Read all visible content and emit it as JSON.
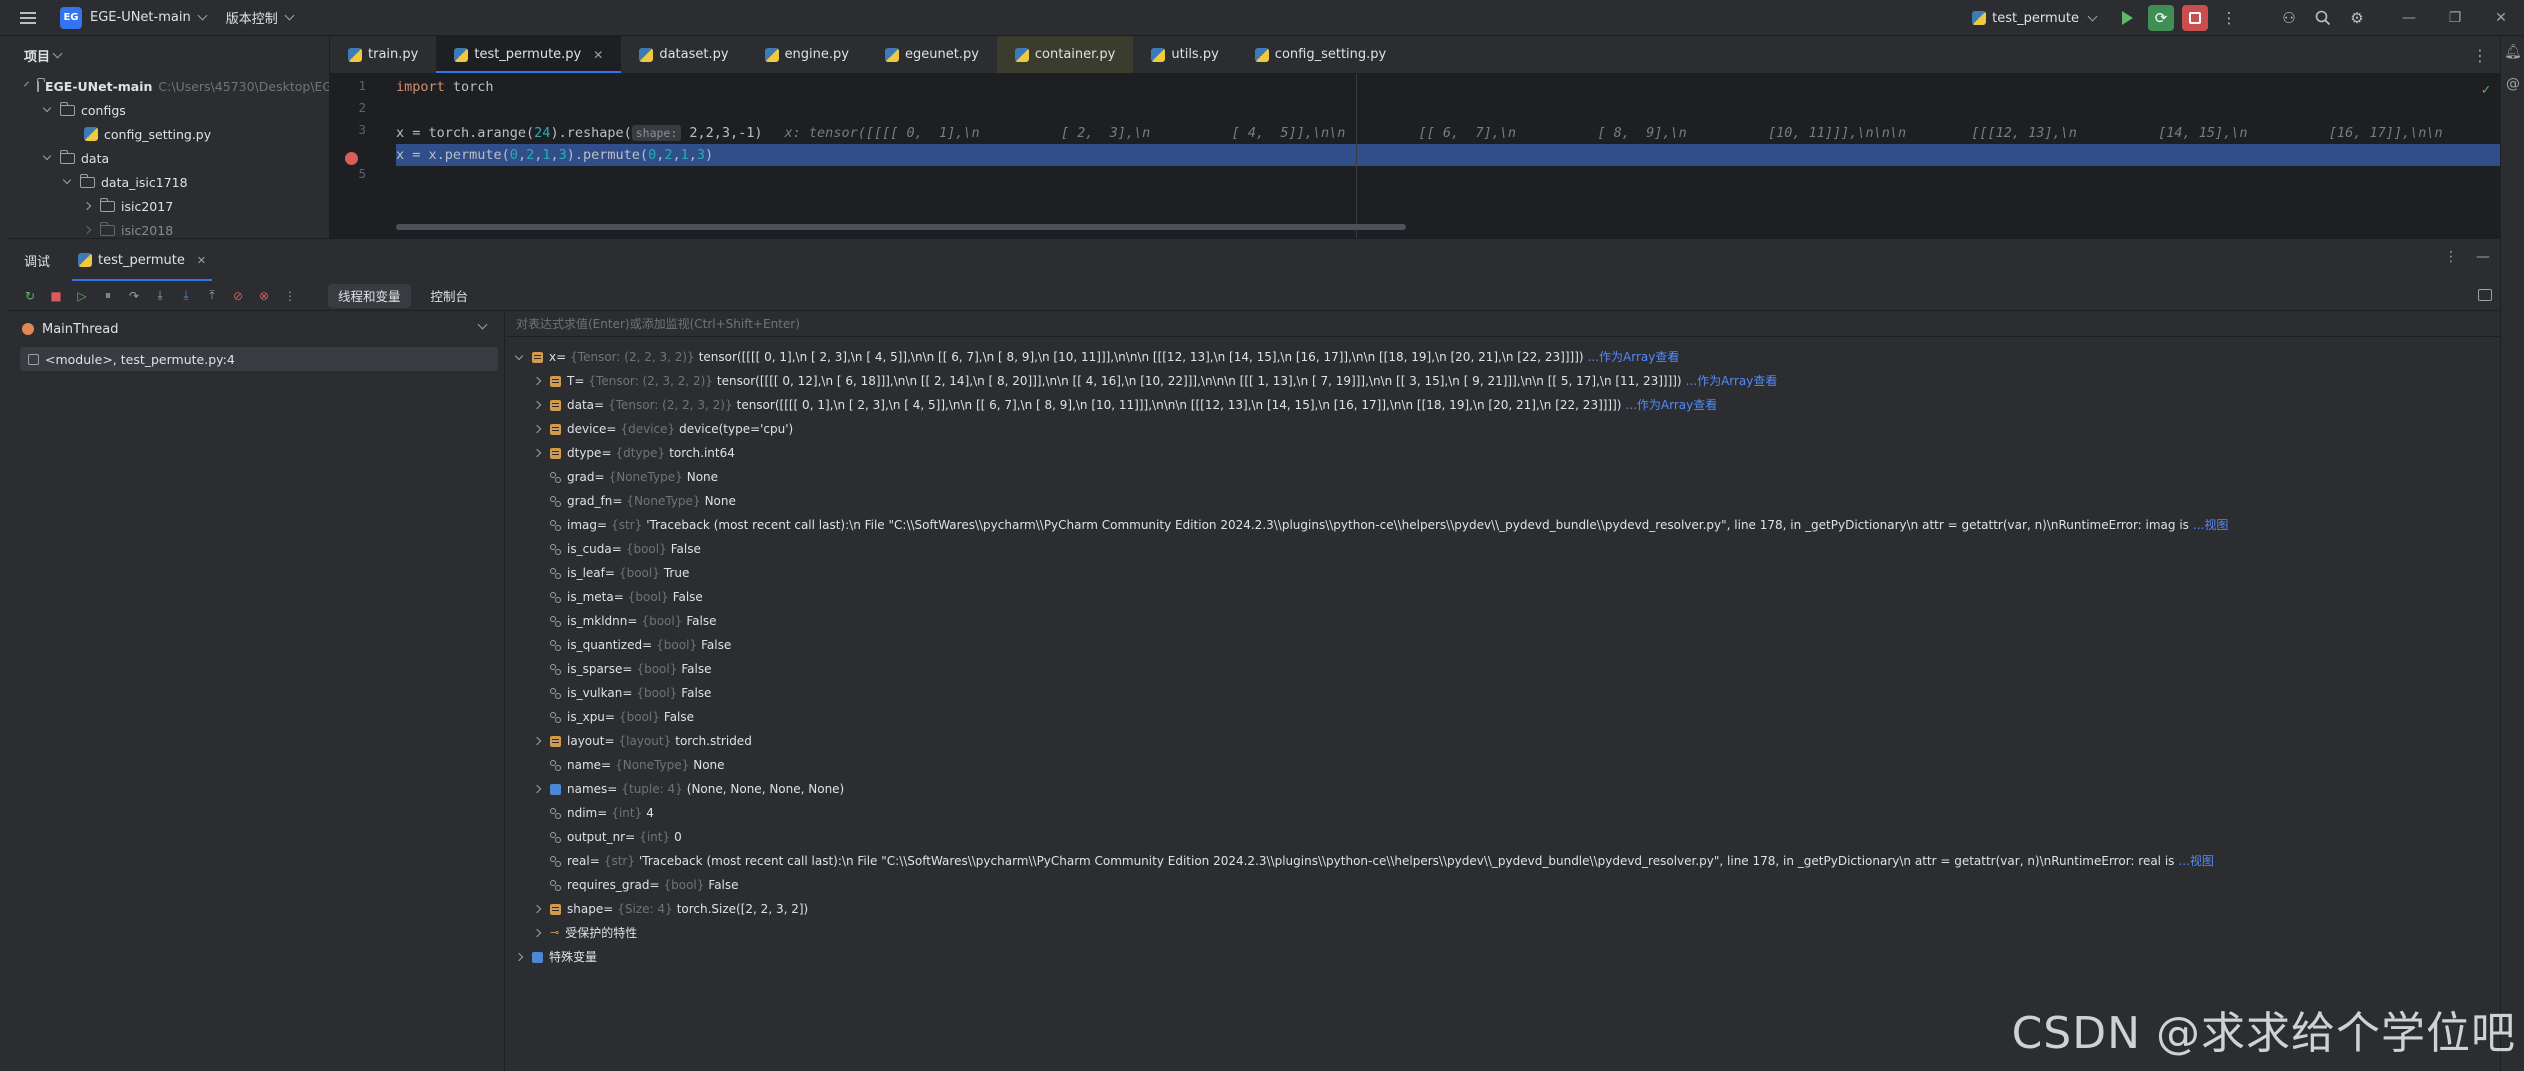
{
  "titlebar": {
    "badge": "EG",
    "project_name": "EGE-UNet-main",
    "vcs_label": "版本控制",
    "run_config": "test_permute"
  },
  "project_panel": {
    "title": "项目",
    "root": {
      "name": "EGE-UNet-main",
      "path": "C:\\Users\\45730\\Desktop\\EG"
    },
    "items": [
      {
        "label": "configs"
      },
      {
        "label": "config_setting.py"
      },
      {
        "label": "data"
      },
      {
        "label": "data_isic1718"
      },
      {
        "label": "isic2017"
      },
      {
        "label": "isic2018"
      }
    ]
  },
  "tabs": [
    {
      "label": "train.py"
    },
    {
      "label": "test_permute.py"
    },
    {
      "label": "dataset.py"
    },
    {
      "label": "engine.py"
    },
    {
      "label": "egeunet.py"
    },
    {
      "label": "container.py"
    },
    {
      "label": "utils.py"
    },
    {
      "label": "config_setting.py"
    }
  ],
  "editor": {
    "line_numbers": [
      "1",
      "2",
      "3",
      "4",
      "5"
    ],
    "line1": {
      "kw": "import",
      "rest": " torch"
    },
    "line3": {
      "a": "x = torch.arange(",
      "n1": "24",
      "b": ").reshape(",
      "hint": "shape:",
      "c": " 2,2,3,-1)",
      "inline": "x: tensor([[[[ 0,  1],\\n          [ 2,  3],\\n          [ 4,  5]],\\n\\n         [[ 6,  7],\\n          [ 8,  9],\\n          [10, 11]]],\\n\\n\\n        [[[12, 13],\\n          [14, 15],\\n          [16, 17]],\\n\\n"
    },
    "line4": {
      "a": "x = x.permute(",
      "n1": "0",
      "s1": ",",
      "n2": "2",
      "s2": ",",
      "n3": "1",
      "s3": ",",
      "n4": "3",
      "b": ").permute(",
      "n5": "0",
      "s5": ",",
      "n6": "2",
      "s6": ",",
      "n7": "1",
      "s7": ",",
      "n8": "3",
      "c": ")"
    }
  },
  "debug": {
    "tool_title": "调试",
    "session_tab": "test_permute",
    "subtab_threads": "线程和变量",
    "subtab_console": "控制台",
    "thread": "MainThread",
    "frame": "<module>, test_permute.py:4",
    "eval_placeholder": "对表达式求值(Enter)或添加监视(Ctrl+Shift+Enter)",
    "variables": [
      {
        "name": "x",
        "type": "{Tensor: (2, 2, 3, 2)}",
        "value": "tensor([[[[ 0,  1],\\n          [ 2,  3],\\n          [ 4,  5]],\\n\\n         [[ 6,  7],\\n          [ 8,  9],\\n          [10, 11]]],\\n\\n\\n        [[[12, 13],\\n          [14, 15],\\n          [16, 17]],\\n\\n         [[18, 19],\\n          [20, 21],\\n          [22, 23]]]])",
        "link": "...作为Array查看"
      },
      {
        "name": "T",
        "type": "{Tensor: (2, 3, 2, 2)}",
        "value": "tensor([[[[ 0, 12],\\n          [ 6, 18]]],\\n\\n         [[ 2, 14],\\n          [ 8, 20]]],\\n\\n         [[ 4, 16],\\n          [10, 22]]],\\n\\n\\n        [[[ 1, 13],\\n          [ 7, 19]]],\\n\\n         [[ 3, 15],\\n          [ 9, 21]]],\\n\\n         [[ 5, 17],\\n          [11, 23]]]])",
        "link": "...作为Array查看"
      },
      {
        "name": "data",
        "type": "{Tensor: (2, 2, 3, 2)}",
        "value": "tensor([[[[ 0,  1],\\n          [ 2,  3],\\n          [ 4,  5]],\\n\\n         [[ 6,  7],\\n          [ 8,  9],\\n          [10, 11]]],\\n\\n\\n        [[[12, 13],\\n          [14, 15],\\n          [16, 17]],\\n\\n         [[18, 19],\\n          [20, 21],\\n          [22, 23]]]])",
        "link": "...作为Array查看"
      },
      {
        "name": "device",
        "type": "{device}",
        "value": "device(type='cpu')",
        "link": ""
      },
      {
        "name": "dtype",
        "type": "{dtype}",
        "value": "torch.int64",
        "link": ""
      },
      {
        "name": "grad",
        "type": "{NoneType}",
        "value": "None",
        "link": ""
      },
      {
        "name": "grad_fn",
        "type": "{NoneType}",
        "value": "None",
        "link": ""
      },
      {
        "name": "imag",
        "type": "{str}",
        "value": "'Traceback (most recent call last):\\n  File \"C:\\\\SoftWares\\\\pycharm\\\\PyCharm Community Edition 2024.2.3\\\\plugins\\\\python-ce\\\\helpers\\\\pydev\\\\_pydevd_bundle\\\\pydevd_resolver.py\", line 178, in _getPyDictionary\\n    attr = getattr(var, n)\\nRuntimeError: imag is",
        "link": "...视图"
      },
      {
        "name": "is_cuda",
        "type": "{bool}",
        "value": "False",
        "link": ""
      },
      {
        "name": "is_leaf",
        "type": "{bool}",
        "value": "True",
        "link": ""
      },
      {
        "name": "is_meta",
        "type": "{bool}",
        "value": "False",
        "link": ""
      },
      {
        "name": "is_mkldnn",
        "type": "{bool}",
        "value": "False",
        "link": ""
      },
      {
        "name": "is_quantized",
        "type": "{bool}",
        "value": "False",
        "link": ""
      },
      {
        "name": "is_sparse",
        "type": "{bool}",
        "value": "False",
        "link": ""
      },
      {
        "name": "is_vulkan",
        "type": "{bool}",
        "value": "False",
        "link": ""
      },
      {
        "name": "is_xpu",
        "type": "{bool}",
        "value": "False",
        "link": ""
      },
      {
        "name": "layout",
        "type": "{layout}",
        "value": "torch.strided",
        "link": ""
      },
      {
        "name": "name",
        "type": "{NoneType}",
        "value": "None",
        "link": ""
      },
      {
        "name": "names",
        "type": "{tuple: 4}",
        "value": "(None, None, None, None)",
        "link": ""
      },
      {
        "name": "ndim",
        "type": "{int}",
        "value": "4",
        "link": ""
      },
      {
        "name": "output_nr",
        "type": "{int}",
        "value": "0",
        "link": ""
      },
      {
        "name": "real",
        "type": "{str}",
        "value": "'Traceback (most recent call last):\\n  File \"C:\\\\SoftWares\\\\pycharm\\\\PyCharm Community Edition 2024.2.3\\\\plugins\\\\python-ce\\\\helpers\\\\pydev\\\\_pydevd_bundle\\\\pydevd_resolver.py\", line 178, in _getPyDictionary\\n    attr = getattr(var, n)\\nRuntimeError: real is",
        "link": "...视图"
      },
      {
        "name": "requires_grad",
        "type": "{bool}",
        "value": "False",
        "link": ""
      },
      {
        "name": "shape",
        "type": "{Size: 4}",
        "value": "torch.Size([2, 2, 3, 2])",
        "link": ""
      }
    ],
    "protected_label": "受保护的特性",
    "special_label": "特殊变量"
  },
  "watermark": "CSDN @求求给个学位吧"
}
